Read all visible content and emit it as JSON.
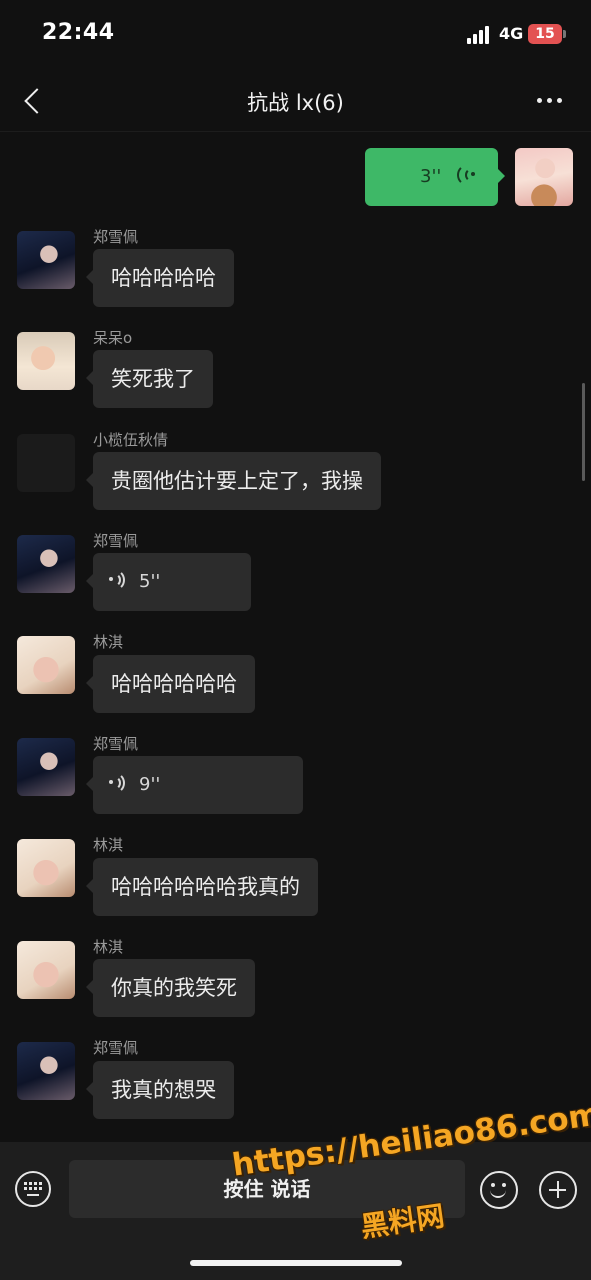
{
  "status_bar": {
    "time": "22:44",
    "network": "4G",
    "battery": "15"
  },
  "header": {
    "title": "抗战 lx(6)"
  },
  "messages": [
    {
      "type": "voice",
      "direction": "out",
      "duration": "3''"
    },
    {
      "sender": "郑雪佩",
      "type": "text",
      "text": "哈哈哈哈哈"
    },
    {
      "sender": "呆呆ο",
      "type": "text",
      "text": "笑死我了"
    },
    {
      "sender": "小榄伍秋倩",
      "type": "text",
      "text": "贵圈他估计要上定了，我操"
    },
    {
      "sender": "郑雪佩",
      "type": "voice",
      "duration": "5''"
    },
    {
      "sender": "林淇",
      "type": "text",
      "text": "哈哈哈哈哈哈"
    },
    {
      "sender": "郑雪佩",
      "type": "voice",
      "duration": "9''"
    },
    {
      "sender": "林淇",
      "type": "text",
      "text": "哈哈哈哈哈哈我真的"
    },
    {
      "sender": "林淇",
      "type": "text",
      "text": "你真的我笑死"
    },
    {
      "sender": "郑雪佩",
      "type": "text",
      "text": "我真的想哭"
    }
  ],
  "input_bar": {
    "hold_to_talk": "按住 说话"
  },
  "watermark": {
    "url": "https://heiliao86.com",
    "name": "黑料网"
  },
  "colors": {
    "background": "#111111",
    "bubble_in": "#2c2c2c",
    "bubble_out": "#3eb867",
    "watermark": "#f5a623"
  }
}
